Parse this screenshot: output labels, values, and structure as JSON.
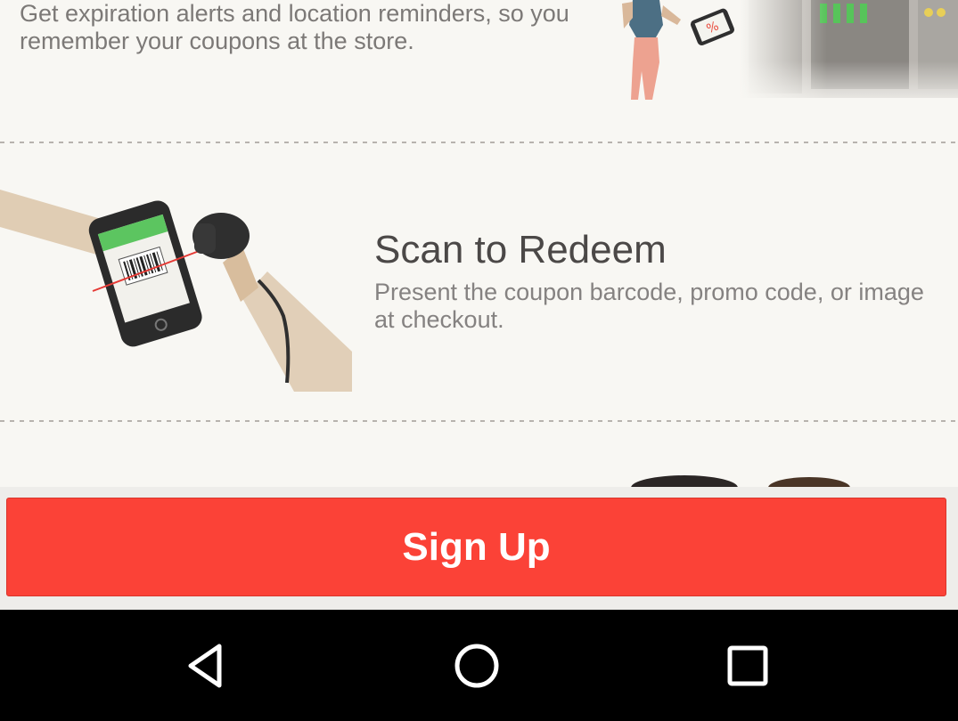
{
  "reminder": {
    "description": "Get expiration alerts and location reminders, so you remember your coupons at the store."
  },
  "scan": {
    "title": "Scan to Redeem",
    "description": "Present the coupon barcode, promo code, or image at checkout."
  },
  "signup": {
    "label": "Sign Up"
  },
  "navigation": {
    "back_icon": "back-triangle-icon",
    "home_icon": "home-circle-icon",
    "recents_icon": "recents-square-icon"
  },
  "colors": {
    "accent": "#fb4237",
    "background": "#f8f7f3",
    "title_text": "#4b4847",
    "body_text": "#858281",
    "nav_bar": "#000000"
  }
}
